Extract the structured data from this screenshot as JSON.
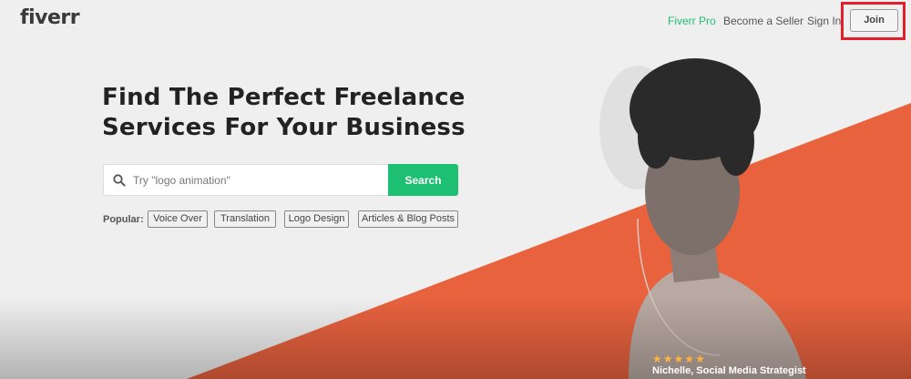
{
  "header": {
    "logo": "fiverr",
    "nav": {
      "pro": "Fiverr Pro",
      "seller": "Become a Seller",
      "signin": "Sign In",
      "join": "Join"
    }
  },
  "hero": {
    "headline_line1": "Find The Perfect Freelance",
    "headline_line2": "Services For Your Business",
    "search": {
      "placeholder": "Try \"logo animation\"",
      "button": "Search"
    },
    "popular": {
      "label": "Popular:",
      "tags": [
        "Voice Over",
        "Translation",
        "Logo Design",
        "Articles & Blog Posts"
      ]
    },
    "testimonial": {
      "stars": "★★★★★",
      "name": "Nichelle, Social Media Strategist"
    }
  },
  "colors": {
    "brand_green": "#1dbf73",
    "accent_orange": "#e8623e",
    "highlight_red": "#e0202a"
  }
}
